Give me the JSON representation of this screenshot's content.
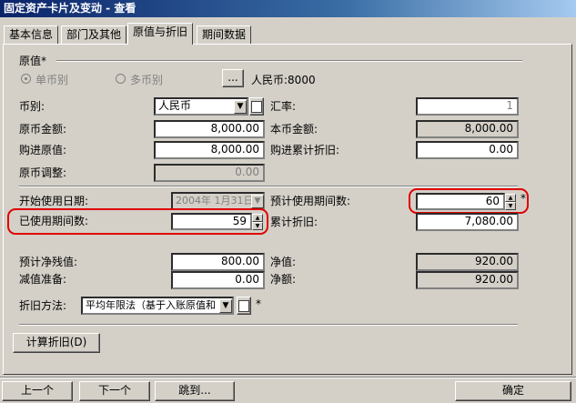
{
  "window": {
    "title": "固定资产卡片及变动 - 查看"
  },
  "tabs": [
    {
      "label": "基本信息"
    },
    {
      "label": "部门及其他"
    },
    {
      "label": "原值与折旧"
    },
    {
      "label": "期间数据"
    }
  ],
  "original_value": {
    "group_label": "原值*",
    "single_currency_label": "单币别",
    "multi_currency_label": "多币别",
    "browse_label": "...",
    "summary": "人民币:8000"
  },
  "fields": {
    "currency_label": "币别:",
    "currency_value": "人民币",
    "exchange_rate_label": "汇率:",
    "exchange_rate_value": "1",
    "orig_amount_label": "原币金额:",
    "orig_amount_value": "8,000.00",
    "local_amount_label": "本币金额:",
    "local_amount_value": "8,000.00",
    "purchase_orig_label": "购进原值:",
    "purchase_orig_value": "8,000.00",
    "purchase_accum_label": "购进累计折旧:",
    "purchase_accum_value": "0.00",
    "orig_adjust_label": "原币调整:",
    "orig_adjust_value": "0.00",
    "start_date_label": "开始使用日期:",
    "start_date_value": "2004年 1月31日",
    "expected_periods_label": "预计使用期间数:",
    "expected_periods_value": "60",
    "used_periods_label": "已使用期间数:",
    "used_periods_value": "59",
    "accum_depr_label": "累计折旧:",
    "accum_depr_value": "7,080.00",
    "residual_label": "预计净残值:",
    "residual_value": "800.00",
    "net_value_label": "净值:",
    "net_value_value": "920.00",
    "impairment_label": "减值准备:",
    "impairment_value": "0.00",
    "net_amount_label": "净额:",
    "net_amount_value": "920.00",
    "depr_method_label": "折旧方法:",
    "depr_method_value": "平均年限法（基于入账原值和",
    "required_mark": "*"
  },
  "buttons": {
    "calc_depr": "计算折旧(D)",
    "prev": "上一个",
    "next": "下一个",
    "jump": "跳到...",
    "ok": "确定"
  }
}
